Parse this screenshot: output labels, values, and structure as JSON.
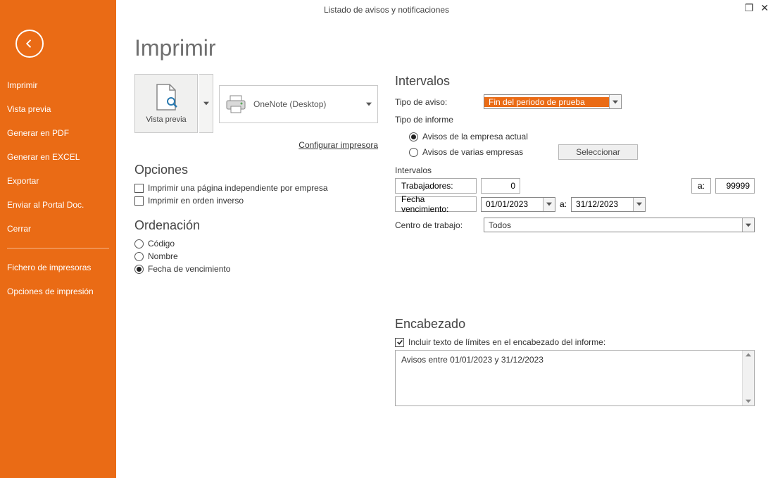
{
  "title": "Listado de avisos y notificaciones",
  "page_heading": "Imprimir",
  "sidebar": {
    "items": [
      "Imprimir",
      "Vista previa",
      "Generar en PDF",
      "Generar en EXCEL",
      "Exportar",
      "Enviar al Portal Doc.",
      "Cerrar"
    ],
    "items2": [
      "Fichero de impresoras",
      "Opciones de impresión"
    ]
  },
  "preview_btn_label": "Vista previa",
  "printer_name": "OneNote (Desktop)",
  "config_printer": "Configurar impresora",
  "sections": {
    "opciones": "Opciones",
    "ordenacion": "Ordenación",
    "intervalos": "Intervalos",
    "encabezado": "Encabezado"
  },
  "opts": {
    "page_per_company": "Imprimir una página independiente por empresa",
    "reverse": "Imprimir en orden inverso"
  },
  "order": {
    "codigo": "Código",
    "nombre": "Nombre",
    "fecha": "Fecha de vencimiento"
  },
  "interv": {
    "tipo_aviso_label": "Tipo de aviso:",
    "tipo_aviso_value": "Fin del periodo de prueba",
    "tipo_informe_label": "Tipo de informe",
    "radio_actual": "Avisos de la empresa actual",
    "radio_varias": "Avisos de varias empresas",
    "select_btn": "Seleccionar",
    "intervalos_label": "Intervalos",
    "trabajadores": "Trabajadores:",
    "trab_from": "0",
    "a": "a:",
    "trab_to": "99999",
    "fecha_venc": "Fecha vencimiento:",
    "date_from": "01/01/2023",
    "date_to": "31/12/2023",
    "centro_label": "Centro de trabajo:",
    "centro_value": "Todos"
  },
  "encabezado": {
    "checkbox": "Incluir texto de límites en el encabezado del informe:",
    "text": "Avisos entre 01/01/2023 y 31/12/2023"
  }
}
